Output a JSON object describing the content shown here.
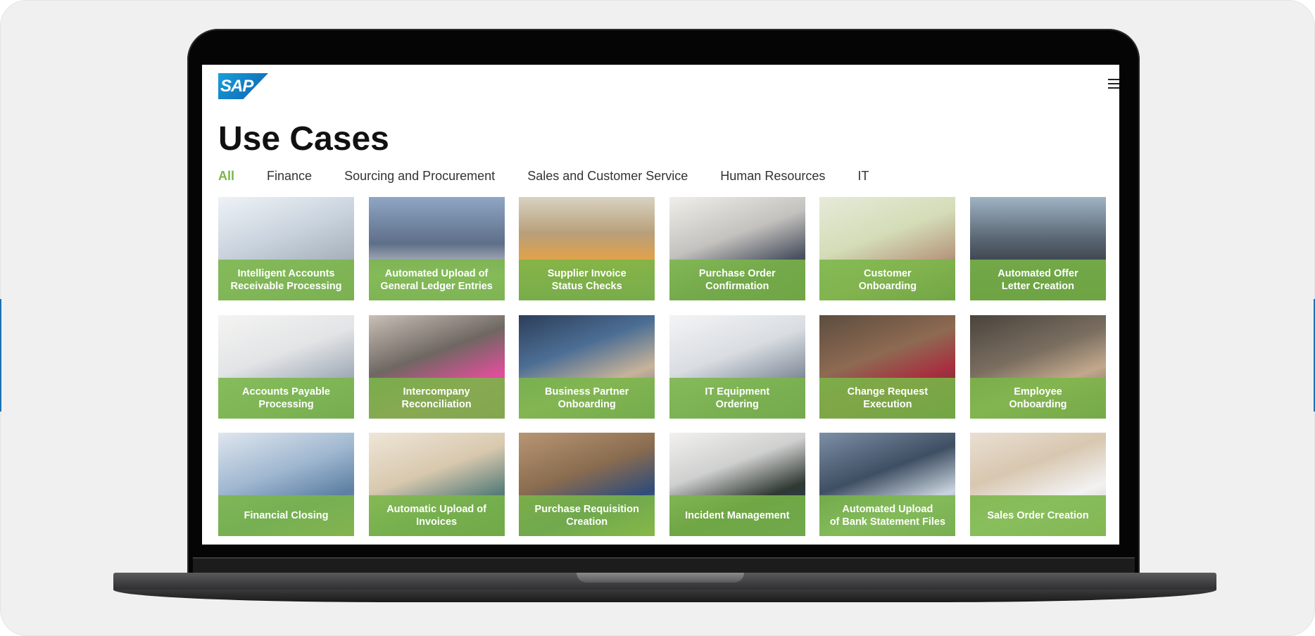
{
  "logo": "SAP",
  "page": {
    "title": "Use Cases"
  },
  "tabs": [
    {
      "label": "All",
      "active": true
    },
    {
      "label": "Finance",
      "active": false
    },
    {
      "label": "Sourcing and Procurement",
      "active": false
    },
    {
      "label": "Sales and Customer Service",
      "active": false
    },
    {
      "label": "Human Resources",
      "active": false
    },
    {
      "label": "IT",
      "active": false
    }
  ],
  "cards": [
    {
      "label": "Intelligent Accounts\nReceivable Processing"
    },
    {
      "label": "Automated Upload of\nGeneral Ledger Entries"
    },
    {
      "label": "Supplier Invoice\nStatus Checks"
    },
    {
      "label": "Purchase Order\nConfirmation"
    },
    {
      "label": "Customer\nOnboarding"
    },
    {
      "label": "Automated Offer\nLetter Creation"
    },
    {
      "label": "Accounts Payable\nProcessing"
    },
    {
      "label": "Intercompany\nReconciliation"
    },
    {
      "label": "Business Partner\nOnboarding"
    },
    {
      "label": "IT Equipment\nOrdering"
    },
    {
      "label": "Change Request\nExecution"
    },
    {
      "label": "Employee\nOnboarding"
    },
    {
      "label": "Financial Closing"
    },
    {
      "label": "Automatic Upload of\nInvoices"
    },
    {
      "label": "Purchase Requisition\nCreation"
    },
    {
      "label": "Incident Management"
    },
    {
      "label": "Automated Upload\nof Bank Statement Files"
    },
    {
      "label": "Sales Order Creation"
    }
  ],
  "colors": {
    "accent": "#7ab648",
    "band": "#7ab648",
    "text": "#111111"
  },
  "icons": {
    "menu": "hamburger-menu-icon"
  }
}
